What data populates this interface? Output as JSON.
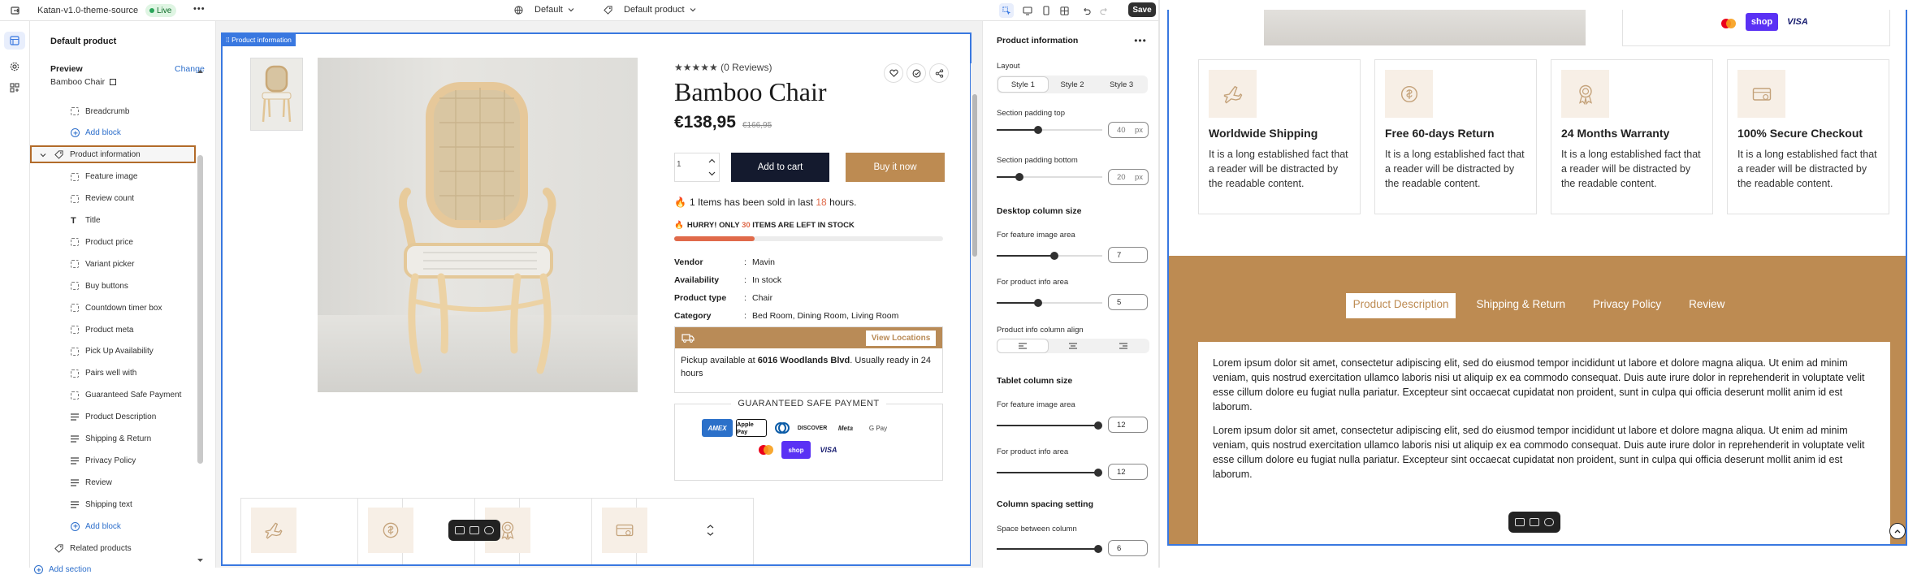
{
  "topbar": {
    "store_name": "Katan-v1.0-theme-source",
    "live_badge": "Live",
    "more": "•••",
    "theme_dropdown": "Default",
    "template_dropdown": "Default product",
    "save": "Save"
  },
  "sidebar": {
    "heading": "Default product",
    "preview_label": "Preview",
    "change_link": "Change",
    "preview_value": "Bamboo Chair",
    "tree": [
      {
        "label": "Breadcrumb",
        "type": "block"
      },
      {
        "label": "Add block",
        "type": "add"
      },
      {
        "label": "Product information",
        "type": "section",
        "selected": true
      },
      {
        "label": "Feature image",
        "type": "block"
      },
      {
        "label": "Review count",
        "type": "block"
      },
      {
        "label": "Title",
        "type": "text"
      },
      {
        "label": "Product price",
        "type": "block"
      },
      {
        "label": "Variant picker",
        "type": "block"
      },
      {
        "label": "Buy buttons",
        "type": "block"
      },
      {
        "label": "Countdown timer box",
        "type": "block"
      },
      {
        "label": "Product meta",
        "type": "block"
      },
      {
        "label": "Pick Up Availability",
        "type": "block"
      },
      {
        "label": "Pairs well with",
        "type": "block"
      },
      {
        "label": "Guaranteed Safe Payment",
        "type": "block"
      },
      {
        "label": "Product Description",
        "type": "lines"
      },
      {
        "label": "Shipping & Return",
        "type": "lines"
      },
      {
        "label": "Privacy Policy",
        "type": "lines"
      },
      {
        "label": "Review",
        "type": "lines"
      },
      {
        "label": "Shipping text",
        "type": "lines"
      },
      {
        "label": "Add block",
        "type": "add"
      },
      {
        "label": "Related products",
        "type": "section"
      },
      {
        "label": "Add section",
        "type": "add"
      }
    ]
  },
  "canvas": {
    "section_tag": "Product information",
    "product": {
      "rating": "★★★★★ (0 Reviews)",
      "title": "Bamboo Chair",
      "price": "€138,95",
      "old_price": "€166,95",
      "quantity": "1",
      "add_to_cart": "Add to cart",
      "buy_now": "Buy it now",
      "sold_pre": "1 Items has been sold in last ",
      "sold_hours": "18",
      "sold_post": " hours.",
      "hurry_pre": "HURRY! ONLY ",
      "hurry_num": "30",
      "hurry_post": " ITEMS ARE LEFT IN STOCK",
      "stock_progress": 0.3,
      "meta": [
        {
          "label": "Vendor",
          "value": "Mavin"
        },
        {
          "label": "Availability",
          "value": "In stock"
        },
        {
          "label": "Product type",
          "value": "Chair"
        },
        {
          "label": "Category",
          "value": "Bed Room,  Dining Room,  Living Room"
        }
      ],
      "view_locations": "View Locations",
      "pickup_pre": "Pickup available at ",
      "pickup_loc": "6016 Woodlands Blvd",
      "pickup_post": ". Usually ready in 24 hours",
      "gsp_title": "GUARANTEED SAFE PAYMENT",
      "payments": [
        "AMEX",
        "Apple Pay",
        "Diners",
        "DISCOVER",
        "Meta",
        "G Pay",
        "Mastercard",
        "shop",
        "VISA"
      ]
    }
  },
  "settings": {
    "title": "Product information",
    "layout_label": "Layout",
    "layout_options": [
      "Style 1",
      "Style 2",
      "Style 3"
    ],
    "pad_top_label": "Section padding top",
    "pad_top_value": "40",
    "pad_bottom_label": "Section padding bottom",
    "pad_bottom_value": "20",
    "unit": "px",
    "desktop_heading": "Desktop column size",
    "feature_area_label": "For feature image area",
    "feature_area_value": "7",
    "info_area_label": "For product info area",
    "info_area_value": "5",
    "align_label": "Product info column align",
    "tablet_heading": "Tablet column size",
    "tablet_feature_label": "For feature image area",
    "tablet_feature_value": "12",
    "tablet_info_label": "For product info area",
    "tablet_info_value": "12",
    "spacing_heading": "Column spacing setting",
    "spacing_label": "Space between column",
    "spacing_value": "6"
  },
  "preview": {
    "features": [
      {
        "icon": "plane-icon",
        "title": "Worldwide Shipping",
        "text": "It is a long established fact that a reader will be distracted by the readable content."
      },
      {
        "icon": "refresh-dollar-icon",
        "title": "Free 60-days Return",
        "text": "It is a long established fact that a reader will be distracted by the readable content."
      },
      {
        "icon": "warranty-badge-icon",
        "title": "24 Months Warranty",
        "text": "It is a long established fact that a reader will be distracted by the readable content."
      },
      {
        "icon": "secure-card-icon",
        "title": "100% Secure Checkout",
        "text": "It is a long established fact that a reader will be distracted by the readable content."
      }
    ],
    "tabs": [
      "Product Description",
      "Shipping & Return",
      "Privacy Policy",
      "Review"
    ],
    "active_tab": "Product Description",
    "paragraphs": [
      "Lorem ipsum dolor sit amet, consectetur adipiscing elit, sed do eiusmod tempor incididunt ut labore et dolore magna aliqua. Ut enim ad minim veniam, quis nostrud exercitation ullamco laboris nisi ut aliquip ex ea commodo consequat. Duis aute irure dolor in reprehenderit in voluptate velit esse cillum dolore eu fugiat nulla pariatur. Excepteur sint occaecat cupidatat non proident, sunt in culpa qui officia deserunt mollit anim id est laborum.",
      "Lorem ipsum dolor sit amet, consectetur adipiscing elit, sed do eiusmod tempor incididunt ut labore et dolore magna aliqua. Ut enim ad minim veniam, quis nostrud exercitation ullamco laboris nisi ut aliquip ex ea commodo consequat. Duis aute irure dolor in reprehenderit in voluptate velit esse cillum dolore eu fugiat nulla pariatur. Excepteur sint occaecat cupidatat non proident, sunt in culpa qui officia deserunt mollit anim id est laborum."
    ]
  },
  "colors": {
    "accent": "#bd8b52",
    "selection": "#3978e0",
    "dark_button": "#141a2e",
    "hurry": "#e06a4a"
  }
}
